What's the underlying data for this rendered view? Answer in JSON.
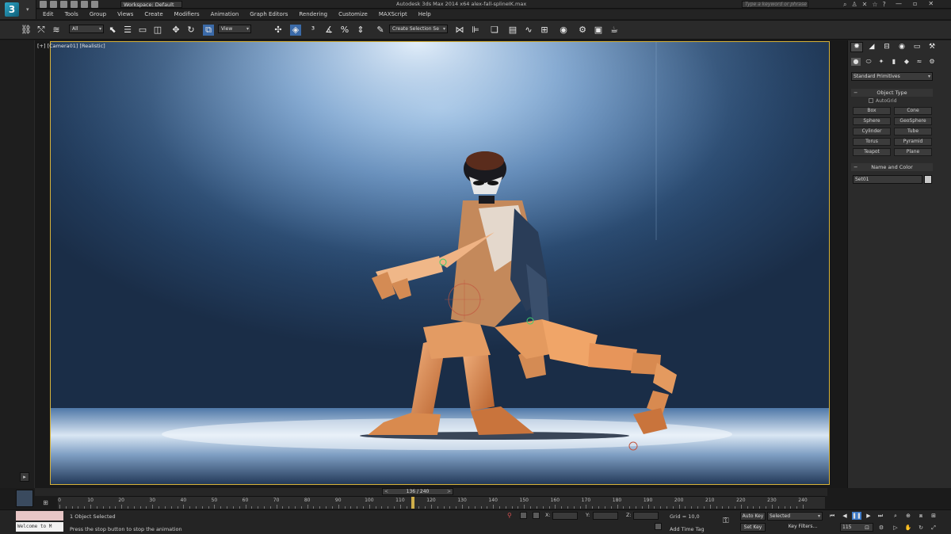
{
  "titlebar": {
    "workspace": "Workspace: Default",
    "title": "Autodesk 3ds Max 2014 x64      alex-fall-splineIK.max",
    "search_placeholder": "Type a keyword or phrase"
  },
  "menu": [
    "Edit",
    "Tools",
    "Group",
    "Views",
    "Create",
    "Modifiers",
    "Animation",
    "Graph Editors",
    "Rendering",
    "Customize",
    "MAXScript",
    "Help"
  ],
  "toolbar": {
    "filter_value": "All",
    "refcoord_value": "View",
    "named_selection_placeholder": "Create Selection Se"
  },
  "viewport": {
    "label": "[+] [Camera01] [Realistic]"
  },
  "command_panel": {
    "category_value": "Standard Primitives",
    "object_type_title": "Object Type",
    "autogrid_label": "AutoGrid",
    "primitives": [
      "Box",
      "Cone",
      "Sphere",
      "GeoSphere",
      "Cylinder",
      "Tube",
      "Torus",
      "Pyramid",
      "Teapot",
      "Plane"
    ],
    "name_color_title": "Name and Color",
    "object_name": "Set01",
    "object_color": "#c9c9c9"
  },
  "timeline": {
    "current_frame": "136 / 240",
    "prev_arrow": "<",
    "next_arrow": ">",
    "ticks": [
      "0",
      "10",
      "20",
      "30",
      "40",
      "50",
      "60",
      "70",
      "80",
      "90",
      "100",
      "110",
      "120",
      "130",
      "140",
      "150",
      "160",
      "170",
      "180",
      "190",
      "200",
      "210",
      "220",
      "230",
      "240"
    ]
  },
  "status": {
    "maxscript_welcome": "Welcome to M",
    "selection_text": "1 Object Selected",
    "prompt_text": "Press the stop button to stop the animation",
    "x_label": "X:",
    "y_label": "Y:",
    "z_label": "Z:",
    "grid_text": "Grid = 10,0",
    "add_time_tag": "Add Time Tag",
    "auto_key": "Auto Key",
    "set_key": "Set Key",
    "key_mode_value": "Selected",
    "key_filters": "Key Filters...",
    "frame_value": "115"
  },
  "colors": {
    "accent": "#d6b23a",
    "play_active": "#3b78c6",
    "lock_red": "#d35050"
  }
}
